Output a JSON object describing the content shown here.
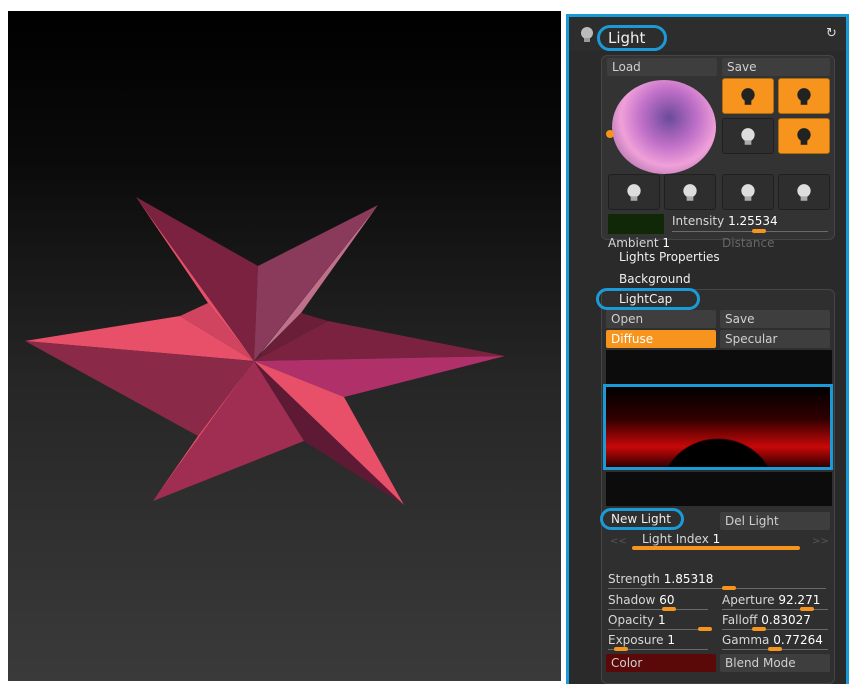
{
  "viewport": {
    "model": "star-mesh",
    "colors": {
      "light_face": "#e8506a",
      "dark_face": "#7a2240",
      "mid_face": "#b0306a",
      "background_top": "#000000",
      "background_bottom": "#3a3a3a"
    }
  },
  "light_panel": {
    "title": "Light",
    "header_icons": [
      "lightbulb-icon",
      "reset-icon"
    ],
    "load_label": "Load",
    "save_label": "Save",
    "light_grid": [
      {
        "active": true
      },
      {
        "active": true
      },
      {
        "active": false
      },
      {
        "active": true
      },
      {
        "active": false
      },
      {
        "active": false
      },
      {
        "active": false
      },
      {
        "active": false
      }
    ],
    "intensity": {
      "label": "Intensity",
      "value": "1.25534"
    },
    "ambient": {
      "label": "Ambient",
      "value": "1"
    },
    "distance": {
      "label": "Distance"
    },
    "accent": "#f7941d",
    "highlight": "#1a9bd8"
  },
  "menu": {
    "lights_properties": "Lights Properties",
    "background": "Background"
  },
  "lightcap": {
    "title": "LightCap",
    "open_label": "Open",
    "save_label": "Save",
    "diffuse_label": "Diffuse",
    "specular_label": "Specular",
    "new_light_label": "New Light",
    "del_light_label": "Del Light",
    "light_index": {
      "label": "Light Index",
      "value": "1"
    },
    "prev_arrow": "<<",
    "next_arrow": ">>",
    "strength": {
      "label": "Strength",
      "value": "1.85318"
    },
    "shadow": {
      "label": "Shadow",
      "value": "60"
    },
    "aperture": {
      "label": "Aperture",
      "value": "92.271"
    },
    "opacity": {
      "label": "Opacity",
      "value": "1"
    },
    "falloff": {
      "label": "Falloff",
      "value": "0.83027"
    },
    "exposure": {
      "label": "Exposure",
      "value": "1"
    },
    "gamma": {
      "label": "Gamma",
      "value": "0.77264"
    },
    "color_label": "Color",
    "blend_mode_label": "Blend Mode",
    "color_swatch": "#5a0808"
  }
}
